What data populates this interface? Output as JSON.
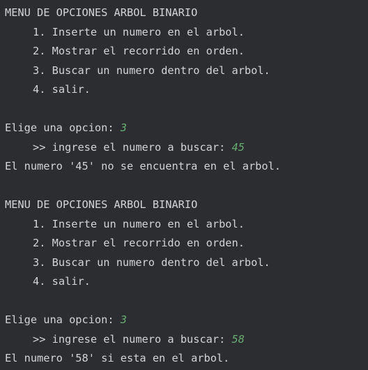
{
  "colors": {
    "background": "#2b2d30",
    "text": "#d2d4d8",
    "user_input": "#6aab73"
  },
  "session": [
    {
      "menu_title": "MENU DE OPCIONES ARBOL BINARIO",
      "options": [
        "1. Inserte un numero en el arbol.",
        "2. Mostrar el recorrido en orden.",
        "3. Buscar un numero dentro del arbol.",
        "4. salir."
      ],
      "prompt": "Elige una opcion: ",
      "choice": "3",
      "search_prompt": ">> ingrese el numero a buscar: ",
      "search_value": "45",
      "result": "El numero '45' no se encuentra en el arbol."
    },
    {
      "menu_title": "MENU DE OPCIONES ARBOL BINARIO",
      "options": [
        "1. Inserte un numero en el arbol.",
        "2. Mostrar el recorrido en orden.",
        "3. Buscar un numero dentro del arbol.",
        "4. salir."
      ],
      "prompt": "Elige una opcion: ",
      "choice": "3",
      "search_prompt": ">> ingrese el numero a buscar: ",
      "search_value": "58",
      "result": "El numero '58' si esta en el arbol."
    }
  ]
}
